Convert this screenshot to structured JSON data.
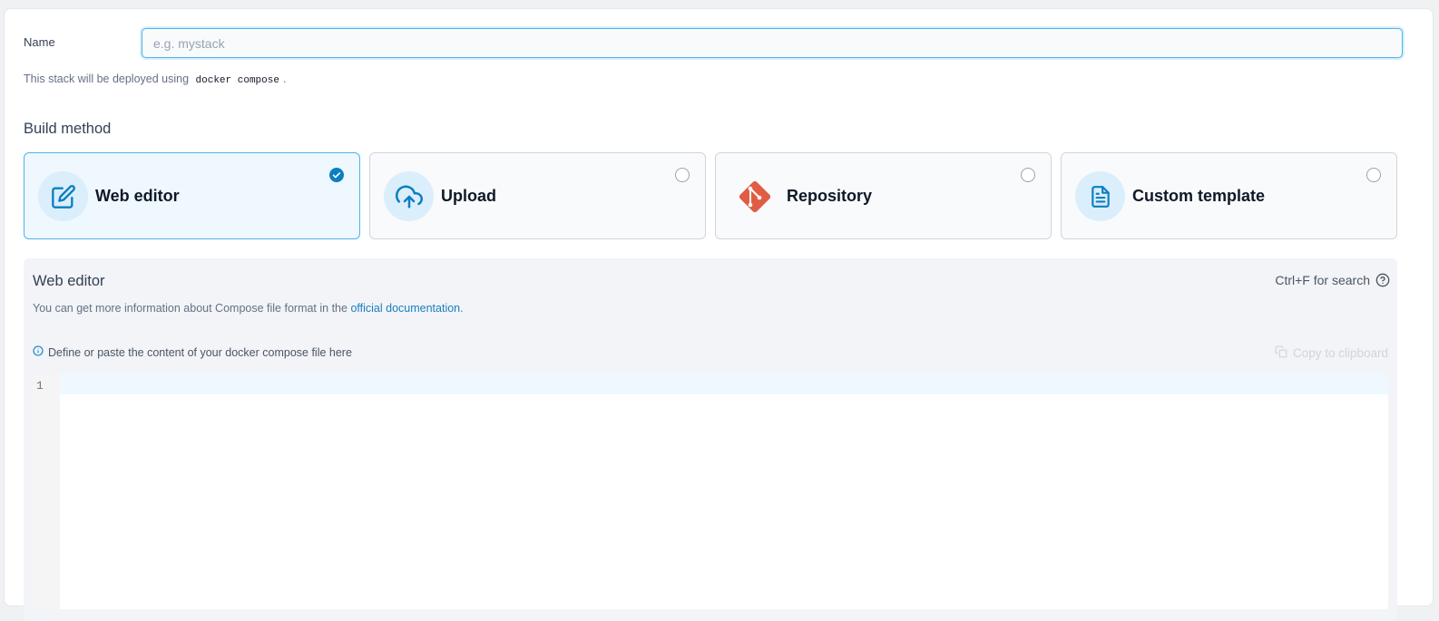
{
  "form": {
    "name_label": "Name",
    "name_placeholder": "e.g. mystack",
    "name_value": "",
    "deploy_prefix": "This stack will be deployed using",
    "deploy_code": "docker compose",
    "deploy_suffix": "."
  },
  "build": {
    "title": "Build method",
    "options": [
      {
        "label": "Web editor",
        "icon": "edit-icon",
        "selected": true
      },
      {
        "label": "Upload",
        "icon": "cloud-upload-icon",
        "selected": false
      },
      {
        "label": "Repository",
        "icon": "git-icon",
        "selected": false
      },
      {
        "label": "Custom template",
        "icon": "file-text-icon",
        "selected": false
      }
    ]
  },
  "editor": {
    "title": "Web editor",
    "search_hint": "Ctrl+F for search",
    "info_prefix": "You can get more information about Compose file format in the",
    "info_link": "official documentation",
    "info_suffix": ".",
    "define_text": "Define or paste the content of your docker compose file here",
    "copy_label": "Copy to clipboard",
    "line_numbers": [
      "1"
    ]
  },
  "colors": {
    "accent": "#0b7fc1",
    "git": "#e05d44",
    "selected_bg": "#eef8fe"
  }
}
